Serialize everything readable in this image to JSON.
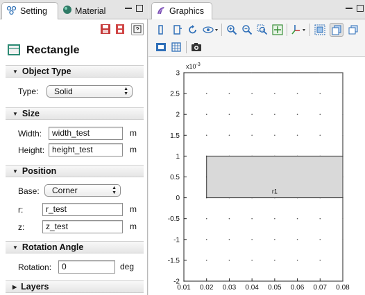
{
  "left_panel": {
    "tabs": [
      {
        "label": "Setting",
        "icon": "settings-icon"
      },
      {
        "label": "Material",
        "icon": "material-icon"
      }
    ],
    "toolbar_icons": [
      "save-icon",
      "build-icon",
      "help-icon"
    ],
    "title": "Rectangle",
    "sections": {
      "object_type": {
        "header": "Object Type",
        "type_label": "Type:",
        "type_value": "Solid"
      },
      "size": {
        "header": "Size",
        "width_label": "Width:",
        "width_value": "width_test",
        "width_unit": "m",
        "height_label": "Height:",
        "height_value": "height_test",
        "height_unit": "m"
      },
      "position": {
        "header": "Position",
        "base_label": "Base:",
        "base_value": "Corner",
        "r_label": "r:",
        "r_value": "r_test",
        "r_unit": "m",
        "z_label": "z:",
        "z_value": "z_test",
        "z_unit": "m"
      },
      "rotation": {
        "header": "Rotation Angle",
        "rotation_label": "Rotation:",
        "rotation_value": "0",
        "rotation_unit": "deg"
      },
      "layers": {
        "header": "Layers"
      }
    }
  },
  "right_panel": {
    "tab_label": "Graphics",
    "tab_icon": "graphics-icon",
    "toolbar_row1": [
      "rotate-icon",
      "view-icon",
      "refresh-icon",
      "visibility-icon",
      "zoom-in-icon",
      "zoom-out-icon",
      "zoom-box-icon",
      "zoom-extents-icon",
      "axes-icon",
      "select-box-icon",
      "select-domain-icon",
      "select-boundary-icon"
    ],
    "toolbar_row2": [
      "transparency-icon",
      "grid-icon",
      "camera-icon"
    ]
  },
  "chart_data": {
    "type": "scatter",
    "x_ticks": [
      "0.01",
      "0.02",
      "0.03",
      "0.04",
      "0.05",
      "0.06",
      "0.07",
      "0.08"
    ],
    "y_ticks": [
      "3",
      "2.5",
      "2",
      "1.5",
      "1",
      "0.5",
      "0",
      "-0.5",
      "-1",
      "-1.5",
      "-2"
    ],
    "y_scale_label": "x10^-3",
    "xlim": [
      0.01,
      0.08
    ],
    "ylim": [
      -2,
      3
    ],
    "grid_points": "dots",
    "rectangle": {
      "x": [
        0.02,
        0.08
      ],
      "y": [
        0,
        1
      ],
      "label": "r1",
      "fill": "#d9d9d9"
    }
  }
}
